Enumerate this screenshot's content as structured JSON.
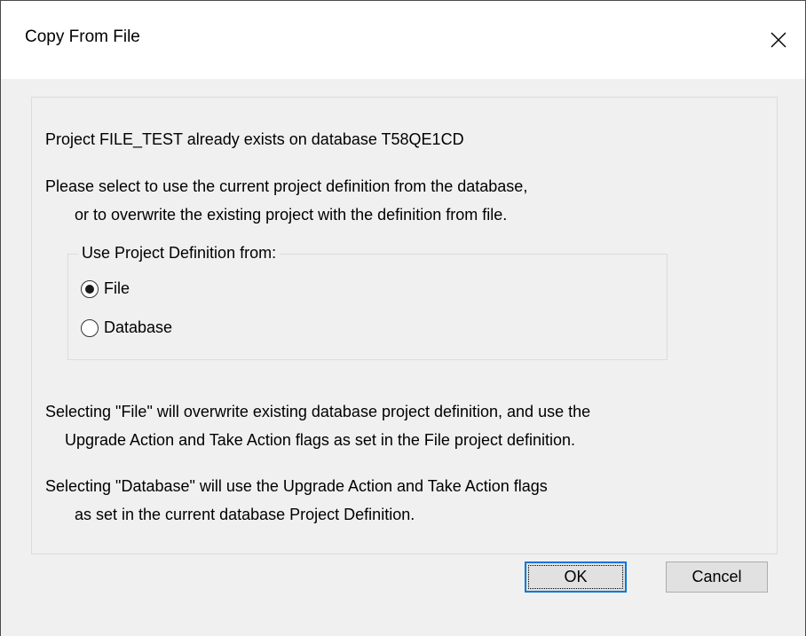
{
  "window": {
    "title": "Copy From File",
    "close_icon": "close-icon"
  },
  "message": {
    "line1": "Project FILE_TEST already exists on database T58QE1CD",
    "line2": "Please select to use the current project definition from the database,",
    "line3": "or to overwrite the existing project with the definition from file."
  },
  "group": {
    "legend": "Use Project Definition from:",
    "options": [
      {
        "label": "File",
        "checked": true
      },
      {
        "label": "Database",
        "checked": false
      }
    ]
  },
  "notes": {
    "file_line1": "Selecting \"File\" will overwrite existing database project definition, and use the",
    "file_line2": "Upgrade Action and Take Action flags as set in the File project definition.",
    "db_line1": "Selecting \"Database\" will use the Upgrade Action and Take Action flags",
    "db_line2": "as set in the current database Project Definition."
  },
  "buttons": {
    "ok_label": "OK",
    "cancel_label": "Cancel"
  },
  "colors": {
    "accent": "#0078d7",
    "background": "#f0f0f0",
    "titlebar": "#ffffff"
  }
}
